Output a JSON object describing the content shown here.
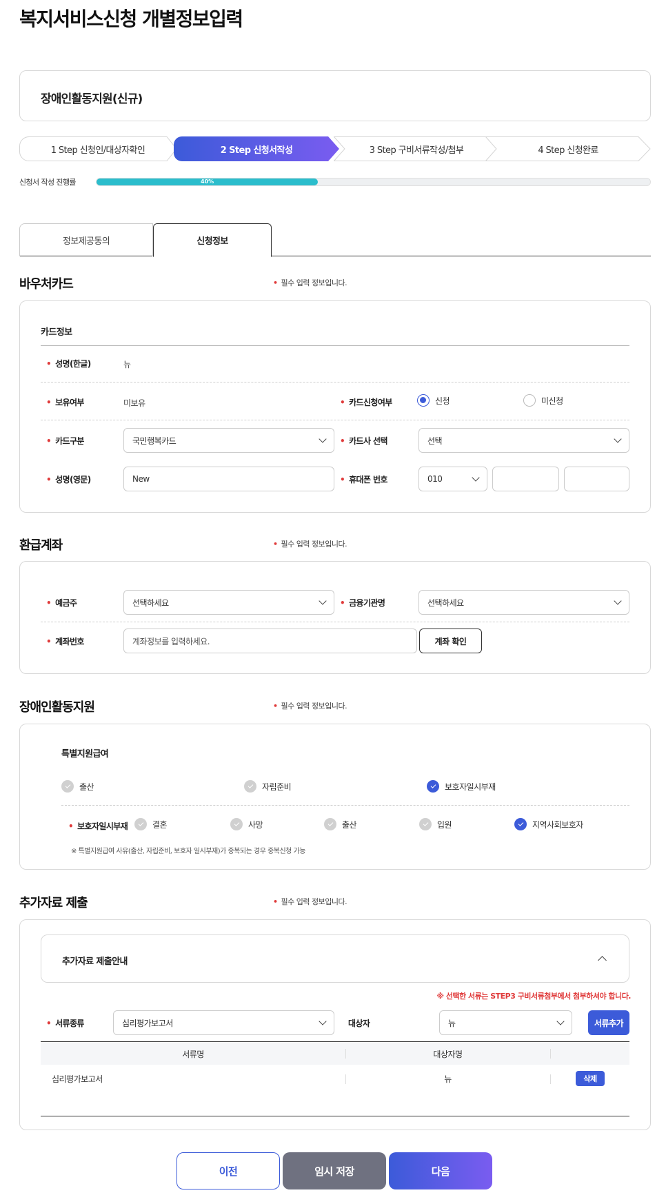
{
  "page_title": "복지서비스신청 개별정보입력",
  "service_name": "장애인활동지원(신규)",
  "steps": [
    {
      "label": "1 Step 신청인/대상자확인"
    },
    {
      "label": "2 Step 신청서작성"
    },
    {
      "label": "3 Step 구비서류작성/첨부"
    },
    {
      "label": "4 Step 신청완료"
    }
  ],
  "progress": {
    "label": "신청서 작성 진행률",
    "value_text": "40%",
    "value": 0.4
  },
  "tabs": [
    {
      "label": "정보제공동의"
    },
    {
      "label": "신청정보"
    }
  ],
  "required_note": "필수 입력 정보입니다.",
  "required_mark": "•",
  "voucher": {
    "title": "바우처카드",
    "card_info_title": "카드정보",
    "name_kr_label": "성명(한글)",
    "name_kr_value": "뉴",
    "own_label": "보유여부",
    "own_value": "미보유",
    "apply_label": "카드신청여부",
    "apply_opt1": "신청",
    "apply_opt2": "미신청",
    "card_type_label": "카드구분",
    "card_type_value": "국민행복카드",
    "card_company_label": "카드사 선택",
    "card_company_value": "선택",
    "name_en_label": "성명(영문)",
    "name_en_value": "New",
    "phone_label": "휴대폰 번호",
    "phone_prefix": "010"
  },
  "refund": {
    "title": "환급계좌",
    "holder_label": "예금주",
    "holder_value": "선택하세요",
    "bank_label": "금융기관명",
    "bank_value": "선택하세요",
    "account_label": "계좌번호",
    "account_placeholder": "계좌정보를 입력하세요.",
    "verify_button": "계좌 확인"
  },
  "support": {
    "title": "장애인활동지원",
    "special_title": "특별지원급여",
    "opt_birth": "출산",
    "opt_independence": "자립준비",
    "opt_guardian_absence": "보호자일시부재",
    "absence_label": "보호자일시부재",
    "sub_marriage": "결혼",
    "sub_death": "사망",
    "sub_birth": "출산",
    "sub_hospital": "입원",
    "sub_community": "지역사회보호자",
    "note": "※ 특별지원급여 사유(출산, 자립준비, 보호자 일시부재)가 중복되는 경우 중복신청 가능"
  },
  "additional": {
    "title": "추가자료 제출",
    "guide_title": "추가자료 제출안내",
    "warning": "※ 선택한 서류는 STEP3 구비서류첨부에서 첨부하셔야 합니다.",
    "doc_type_label": "서류종류",
    "doc_type_value": "심리평가보고서",
    "target_label": "대상자",
    "target_value": "뉴",
    "add_button": "서류추가",
    "col_doc_name": "서류명",
    "col_target_name": "대상자명",
    "row_doc": "심리평가보고서",
    "row_target": "뉴",
    "delete_button": "삭제"
  },
  "buttons": {
    "prev": "이전",
    "save": "임시 저장",
    "next": "다음"
  },
  "colors": {
    "primary": "#3c5bd9",
    "progress": "#2bbdcc",
    "required": "#e03b3b",
    "gray_button": "#6f7180"
  }
}
